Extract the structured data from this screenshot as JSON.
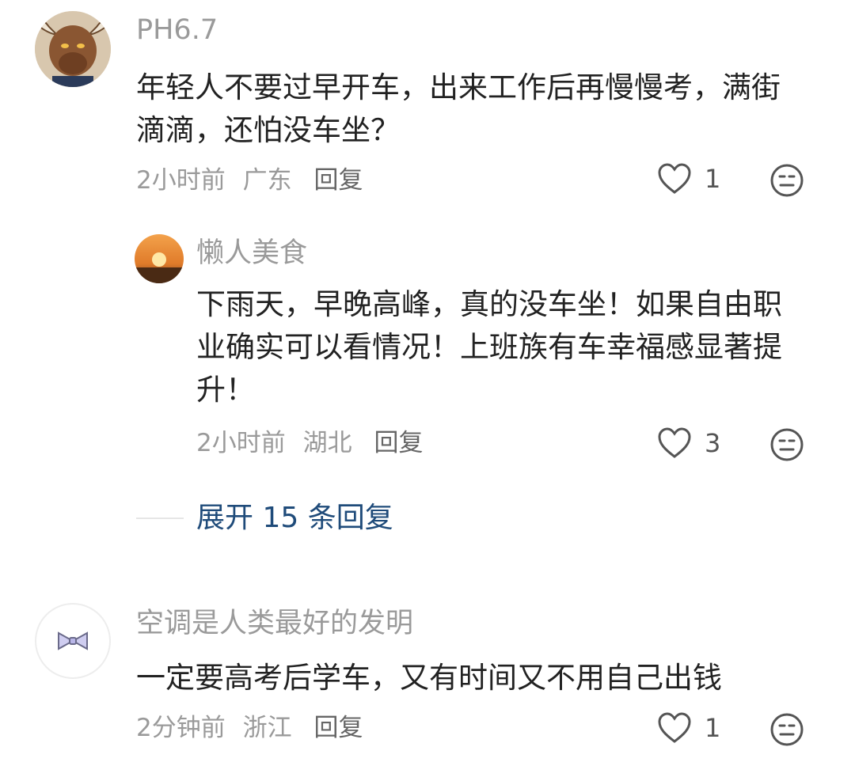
{
  "comments": [
    {
      "username": "PH6.7",
      "text": "年轻人不要过早开车，出来工作后再慢慢考，满街滴滴，还怕没车坐？",
      "time": "2小时前",
      "location": "广东",
      "reply_label": "回复",
      "likes": "1",
      "avatar_icon": "bull-avatar",
      "reply": {
        "username": "懒人美食",
        "text": "下雨天，早晚高峰，真的没车坐！如果自由职业确实可以看情况！上班族有车幸福感显著提升！",
        "time": "2小时前",
        "location": "湖北",
        "reply_label": "回复",
        "likes": "3",
        "avatar_icon": "sunset-avatar"
      },
      "expand_label": "展开 15 条回复"
    },
    {
      "username": "空调是人类最好的发明",
      "text": "一定要高考后学车，又有时间又不用自己出钱",
      "time": "2分钟前",
      "location": "浙江",
      "reply_label": "回复",
      "likes": "1",
      "avatar_icon": "bowtie-avatar"
    }
  ],
  "icons": {
    "like": "heart-icon",
    "emoji": "emoji-face-icon"
  },
  "colors": {
    "expand_link": "#1f4b7a",
    "meta": "#9a9a9a",
    "body_text": "#222222"
  }
}
